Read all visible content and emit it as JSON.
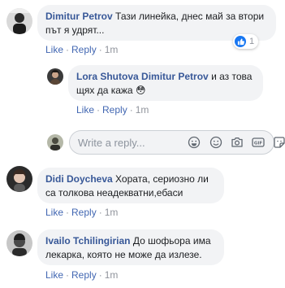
{
  "comments": [
    {
      "author": "Dimitur Petrov",
      "text": "Тази линейка, днес май за втори път я удрят...",
      "actions": {
        "like": "Like",
        "reply": "Reply",
        "time": "1m"
      },
      "reactions": {
        "icon": "like-icon",
        "count": "1"
      },
      "replies": [
        {
          "author": "Lora Shutova",
          "mention": "Dimitur Petrov",
          "text": "и аз това щях да кажа 😳",
          "actions": {
            "like": "Like",
            "reply": "Reply",
            "time": "1m"
          }
        }
      ]
    },
    {
      "author": "Didi Doycheva",
      "text": "Хората, сериозно ли са толкова неадекватни,ебаси",
      "actions": {
        "like": "Like",
        "reply": "Reply",
        "time": "1m"
      }
    },
    {
      "author": "Ivailo Tchilingirian",
      "text": "До шофьора има лекарка, която не може да излезе.",
      "actions": {
        "like": "Like",
        "reply": "Reply",
        "time": "1m"
      }
    }
  ],
  "reply_input": {
    "placeholder": "Write a reply..."
  },
  "reply_tools": [
    "emoji-icon",
    "smiley-icon",
    "camera-icon",
    "gif-icon",
    "sticker-icon"
  ],
  "colors": {
    "author": "#385898",
    "link": "#4267b2",
    "bubble": "#f2f3f5",
    "meta": "#90949c",
    "like": "#1877f2"
  }
}
